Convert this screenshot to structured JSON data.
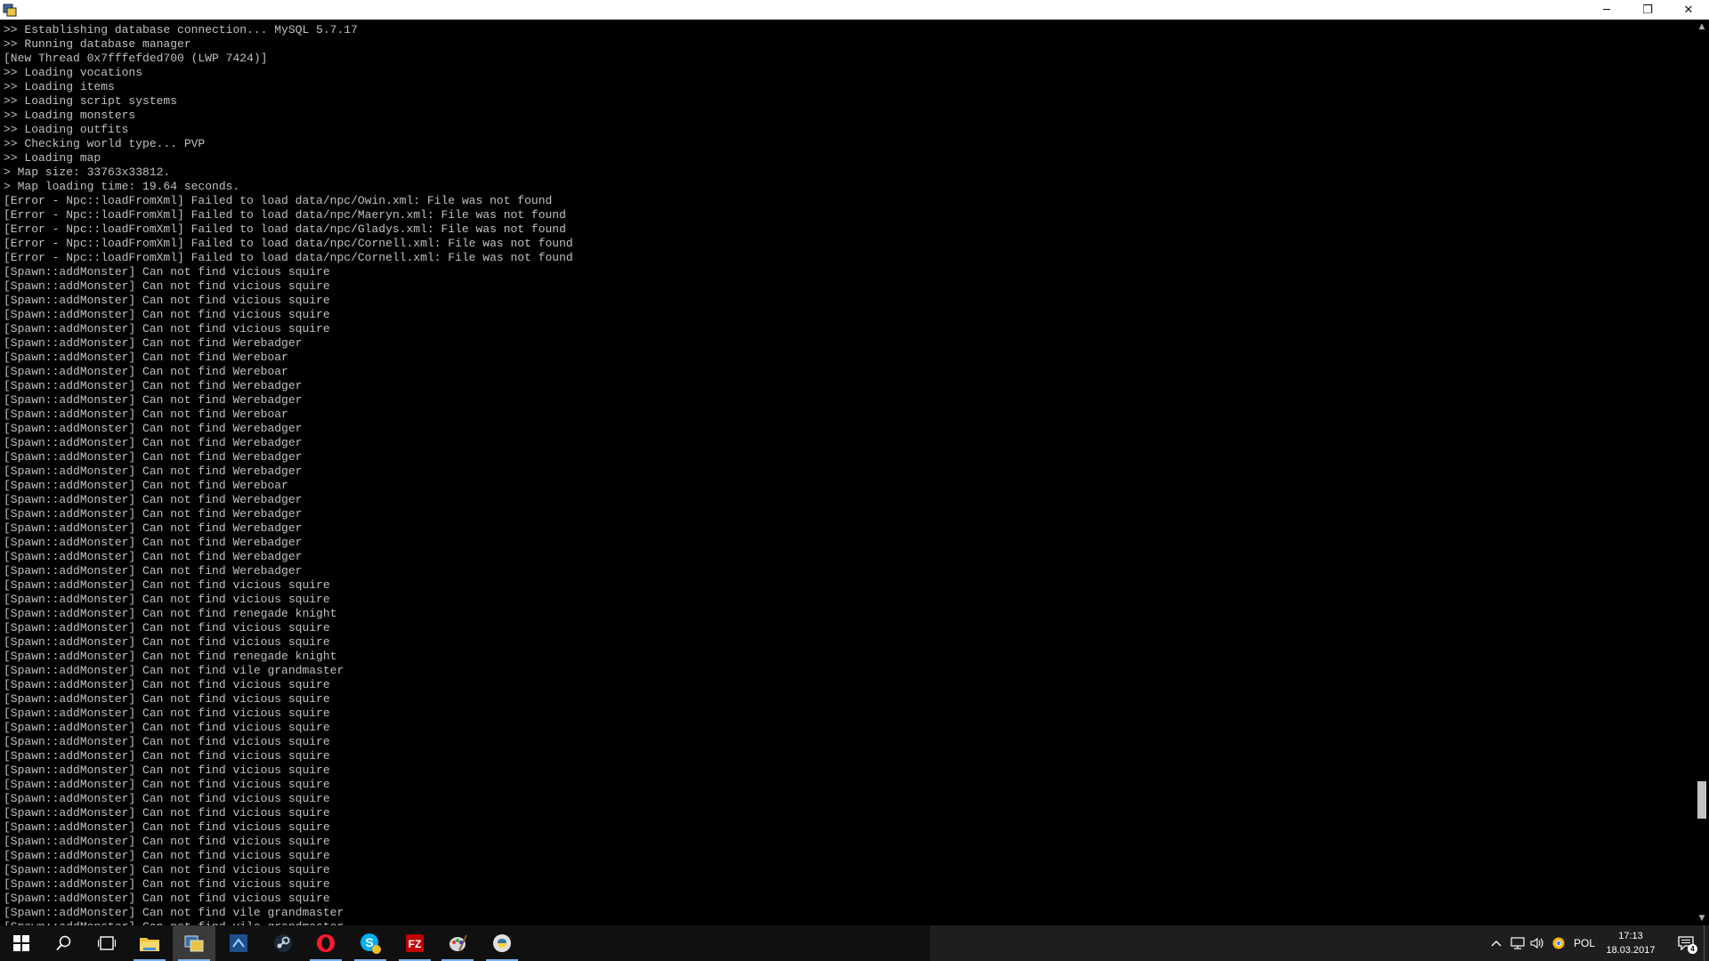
{
  "window": {
    "minimize_glyph": "─",
    "restore_glyph": "❐",
    "close_glyph": "✕"
  },
  "console": {
    "lines": [
      ">> Establishing database connection... MySQL 5.7.17",
      ">> Running database manager",
      "[New Thread 0x7fffefded700 (LWP 7424)]",
      ">> Loading vocations",
      ">> Loading items",
      ">> Loading script systems",
      ">> Loading monsters",
      ">> Loading outfits",
      ">> Checking world type... PVP",
      ">> Loading map",
      "> Map size: 33763x33812.",
      "> Map loading time: 19.64 seconds.",
      "[Error - Npc::loadFromXml] Failed to load data/npc/Owin.xml: File was not found",
      "[Error - Npc::loadFromXml] Failed to load data/npc/Maeryn.xml: File was not found",
      "[Error - Npc::loadFromXml] Failed to load data/npc/Gladys.xml: File was not found",
      "[Error - Npc::loadFromXml] Failed to load data/npc/Cornell.xml: File was not found",
      "[Error - Npc::loadFromXml] Failed to load data/npc/Cornell.xml: File was not found",
      "[Spawn::addMonster] Can not find vicious squire",
      "[Spawn::addMonster] Can not find vicious squire",
      "[Spawn::addMonster] Can not find vicious squire",
      "[Spawn::addMonster] Can not find vicious squire",
      "[Spawn::addMonster] Can not find vicious squire",
      "[Spawn::addMonster] Can not find Werebadger",
      "[Spawn::addMonster] Can not find Wereboar",
      "[Spawn::addMonster] Can not find Wereboar",
      "[Spawn::addMonster] Can not find Werebadger",
      "[Spawn::addMonster] Can not find Werebadger",
      "[Spawn::addMonster] Can not find Wereboar",
      "[Spawn::addMonster] Can not find Werebadger",
      "[Spawn::addMonster] Can not find Werebadger",
      "[Spawn::addMonster] Can not find Werebadger",
      "[Spawn::addMonster] Can not find Werebadger",
      "[Spawn::addMonster] Can not find Wereboar",
      "[Spawn::addMonster] Can not find Werebadger",
      "[Spawn::addMonster] Can not find Werebadger",
      "[Spawn::addMonster] Can not find Werebadger",
      "[Spawn::addMonster] Can not find Werebadger",
      "[Spawn::addMonster] Can not find Werebadger",
      "[Spawn::addMonster] Can not find Werebadger",
      "[Spawn::addMonster] Can not find vicious squire",
      "[Spawn::addMonster] Can not find vicious squire",
      "[Spawn::addMonster] Can not find renegade knight",
      "[Spawn::addMonster] Can not find vicious squire",
      "[Spawn::addMonster] Can not find vicious squire",
      "[Spawn::addMonster] Can not find renegade knight",
      "[Spawn::addMonster] Can not find vile grandmaster",
      "[Spawn::addMonster] Can not find vicious squire",
      "[Spawn::addMonster] Can not find vicious squire",
      "[Spawn::addMonster] Can not find vicious squire",
      "[Spawn::addMonster] Can not find vicious squire",
      "[Spawn::addMonster] Can not find vicious squire",
      "[Spawn::addMonster] Can not find vicious squire",
      "[Spawn::addMonster] Can not find vicious squire",
      "[Spawn::addMonster] Can not find vicious squire",
      "[Spawn::addMonster] Can not find vicious squire",
      "[Spawn::addMonster] Can not find vicious squire",
      "[Spawn::addMonster] Can not find vicious squire",
      "[Spawn::addMonster] Can not find vicious squire",
      "[Spawn::addMonster] Can not find vicious squire",
      "[Spawn::addMonster] Can not find vicious squire",
      "[Spawn::addMonster] Can not find vicious squire",
      "[Spawn::addMonster] Can not find vicious squire",
      "[Spawn::addMonster] Can not find vile grandmaster",
      "[Spawn::addMonster] Can not find vile grandmaster"
    ]
  },
  "taskbar": {
    "apps": [
      {
        "icon": "file-explorer-icon",
        "state": "running"
      },
      {
        "icon": "terminal-app-icon",
        "state": "active"
      },
      {
        "icon": "visual-studio-icon",
        "state": "idle"
      },
      {
        "icon": "steam-icon",
        "state": "idle"
      },
      {
        "icon": "opera-icon",
        "state": "running"
      },
      {
        "icon": "skype-icon",
        "state": "running"
      },
      {
        "icon": "filezilla-icon",
        "state": "running"
      },
      {
        "icon": "paint-app-icon",
        "state": "running"
      },
      {
        "icon": "python-icon",
        "state": "running"
      }
    ],
    "tray": {
      "language": "POL",
      "time": "17:13",
      "date": "18.03.2017",
      "notification_count": "4"
    }
  },
  "colors": {
    "console_text": "#c0c0c0",
    "console_bg": "#000000",
    "taskbar_bg": "#101010",
    "taskbar_accent": "#7eb4ea"
  }
}
